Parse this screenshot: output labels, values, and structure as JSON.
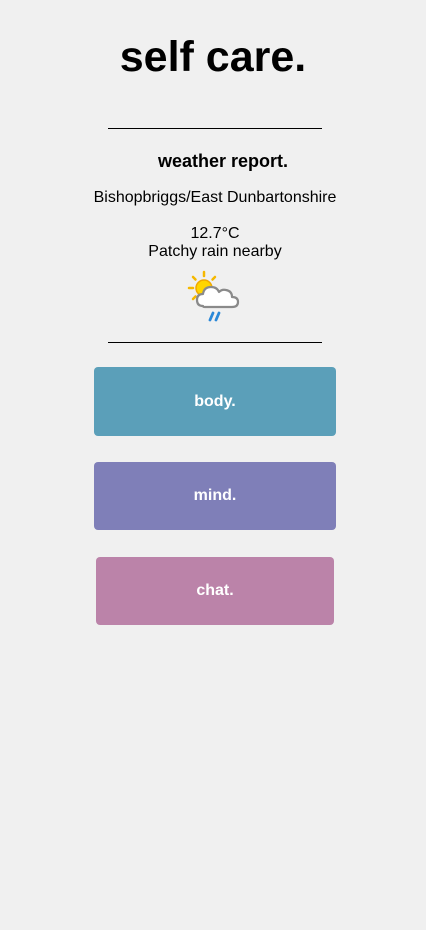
{
  "header": {
    "title": "self care."
  },
  "weather": {
    "heading": "weather report.",
    "location": "Bishopbriggs/East Dunbartonshire",
    "temperature": "12.7°C",
    "condition": "Patchy rain nearby",
    "icon": "partly-cloudy-rain-icon"
  },
  "nav": {
    "body_label": "body.",
    "mind_label": "mind.",
    "chat_label": "chat."
  },
  "colors": {
    "background": "#f0f0f0",
    "body_button": "#5b9fb9",
    "mind_button": "#7f7fb8",
    "chat_button": "#bb83a9",
    "button_text": "#ffffff"
  }
}
